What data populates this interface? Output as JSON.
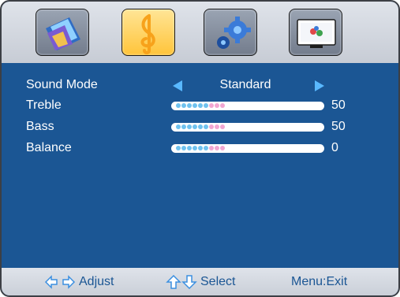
{
  "tabs": [
    {
      "icon": "picture-icon",
      "active": false
    },
    {
      "icon": "music-note-icon",
      "active": true
    },
    {
      "icon": "gears-icon",
      "active": false
    },
    {
      "icon": "screen-icon",
      "active": false
    }
  ],
  "menu": {
    "sound_mode": {
      "label": "Sound Mode",
      "value": "Standard"
    },
    "treble": {
      "label": "Treble",
      "value": "50"
    },
    "bass": {
      "label": "Bass",
      "value": "50"
    },
    "balance": {
      "label": "Balance",
      "value": "0"
    }
  },
  "footer": {
    "adjust": "Adjust",
    "select": "Select",
    "menu_exit": "Menu:Exit"
  },
  "colors": {
    "background": "#1b5694",
    "accent_arrow": "#59b8ff",
    "dot_blue": "#6fc2ef",
    "dot_pink": "#f2a6d2"
  }
}
